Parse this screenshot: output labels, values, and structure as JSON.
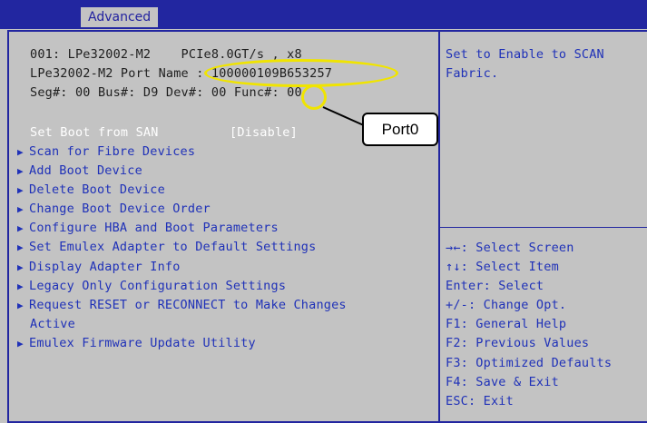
{
  "header": {
    "tab_label": "Advanced"
  },
  "adapter": {
    "line1": "001: LPe32002-M2    PCIe8.0GT/s , x8",
    "line2": "LPe32002-M2 Port Name : 100000109B653257",
    "line3": "Seg#: 00 Bus#: D9 Dev#: 00 Func#: 00"
  },
  "boot_from_san": {
    "label": "Set Boot from SAN",
    "value": "[Disable]"
  },
  "menu": {
    "items": [
      {
        "label": "Scan for Fibre Devices"
      },
      {
        "label": "Add Boot Device"
      },
      {
        "label": "Delete Boot Device"
      },
      {
        "label": "Change Boot Device Order"
      },
      {
        "label": "Configure HBA and Boot Parameters"
      },
      {
        "label": "Set Emulex Adapter to Default Settings"
      },
      {
        "label": "Display Adapter Info"
      },
      {
        "label": "Legacy Only Configuration Settings"
      },
      {
        "label": "Request RESET or RECONNECT to Make Changes",
        "continuation": "Active"
      },
      {
        "label": "Emulex Firmware Update Utility"
      }
    ]
  },
  "help_panel": {
    "line1": "Set to Enable to SCAN",
    "line2": "Fabric."
  },
  "key_legend": [
    "→←: Select Screen",
    "↑↓: Select Item",
    "Enter: Select",
    "+/-: Change Opt.",
    "F1: General Help",
    "F2: Previous Values",
    "F3: Optimized Defaults",
    "F4: Save & Exit",
    "ESC: Exit"
  ],
  "annotation": {
    "callout_label": "Port0"
  },
  "icons": {
    "submenu_arrow": "submenu-triangle-icon"
  },
  "colors": {
    "header_bar": "#2226a0",
    "background": "#c3c3c3",
    "menu_text": "#1f31b8",
    "highlight_ellipse": "#f0e400"
  }
}
